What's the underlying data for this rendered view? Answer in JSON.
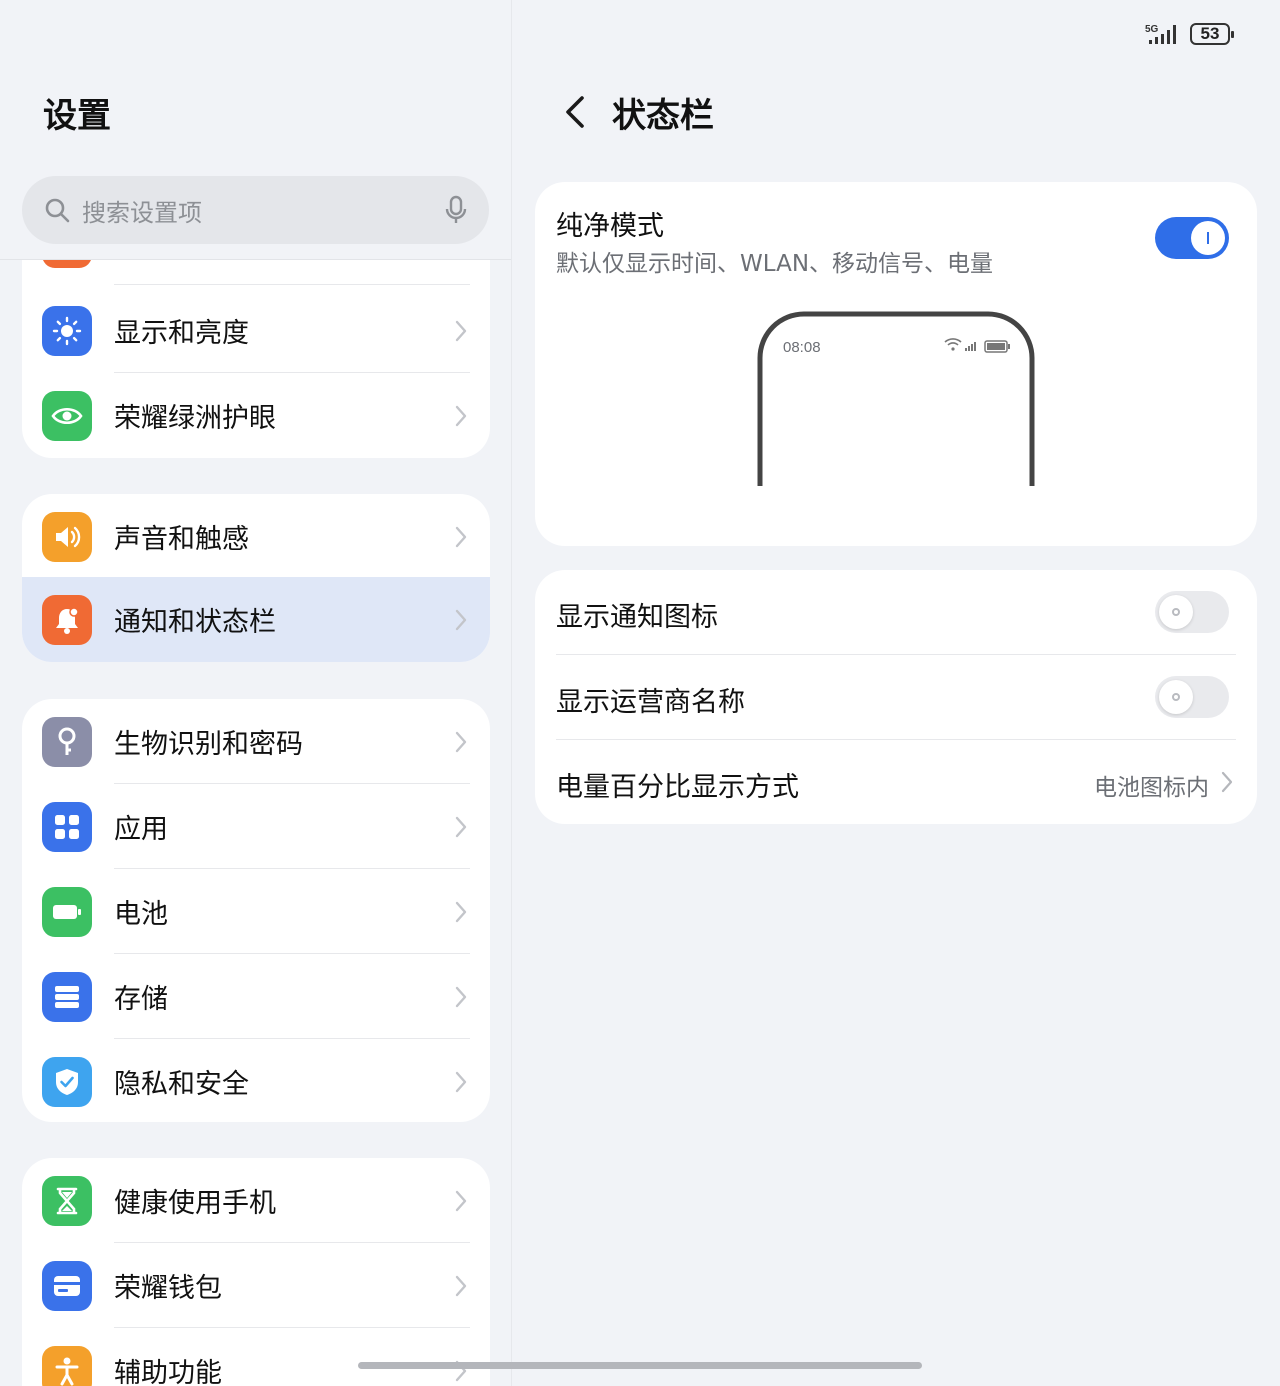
{
  "status_bar": {
    "network": "5G",
    "battery": "53"
  },
  "left": {
    "title": "设置",
    "search_placeholder": "搜索设置项",
    "groups": [
      {
        "items": [
          {
            "label": "显示和亮度",
            "icon": "sun-icon",
            "color": "#3a72ea"
          },
          {
            "label": "荣耀绿洲护眼",
            "icon": "eye-icon",
            "color": "#3cc063"
          }
        ]
      },
      {
        "items": [
          {
            "label": "声音和触感",
            "icon": "speaker-icon",
            "color": "#f4a02b"
          },
          {
            "label": "通知和状态栏",
            "icon": "bell-icon",
            "color": "#f06a34",
            "selected": true
          }
        ]
      },
      {
        "items": [
          {
            "label": "生物识别和密码",
            "icon": "key-icon",
            "color": "#8b8ea8"
          },
          {
            "label": "应用",
            "icon": "grid-icon",
            "color": "#3a72ea"
          },
          {
            "label": "电池",
            "icon": "battery-icon",
            "color": "#3cc063"
          },
          {
            "label": "存储",
            "icon": "storage-icon",
            "color": "#3a72ea"
          },
          {
            "label": "隐私和安全",
            "icon": "shield-icon",
            "color": "#3ea4ef"
          }
        ]
      },
      {
        "items": [
          {
            "label": "健康使用手机",
            "icon": "hourglass-icon",
            "color": "#3cc063"
          },
          {
            "label": "荣耀钱包",
            "icon": "wallet-icon",
            "color": "#3a72ea"
          },
          {
            "label": "辅助功能",
            "icon": "accessibility-icon",
            "color": "#f4a02b"
          }
        ]
      }
    ]
  },
  "right": {
    "title": "状态栏",
    "pure_mode": {
      "title": "纯净模式",
      "description": "默认仅显示时间、WLAN、移动信号、电量",
      "enabled": true,
      "preview_time": "08:08"
    },
    "options": [
      {
        "label": "显示通知图标",
        "type": "toggle",
        "enabled": false
      },
      {
        "label": "显示运营商名称",
        "type": "toggle",
        "enabled": false
      },
      {
        "label": "电量百分比显示方式",
        "type": "select",
        "value": "电池图标内"
      }
    ]
  },
  "colors": {
    "accent": "#2f6ee8",
    "selected_row": "#dfe7f7",
    "background": "#f1f3f7"
  }
}
